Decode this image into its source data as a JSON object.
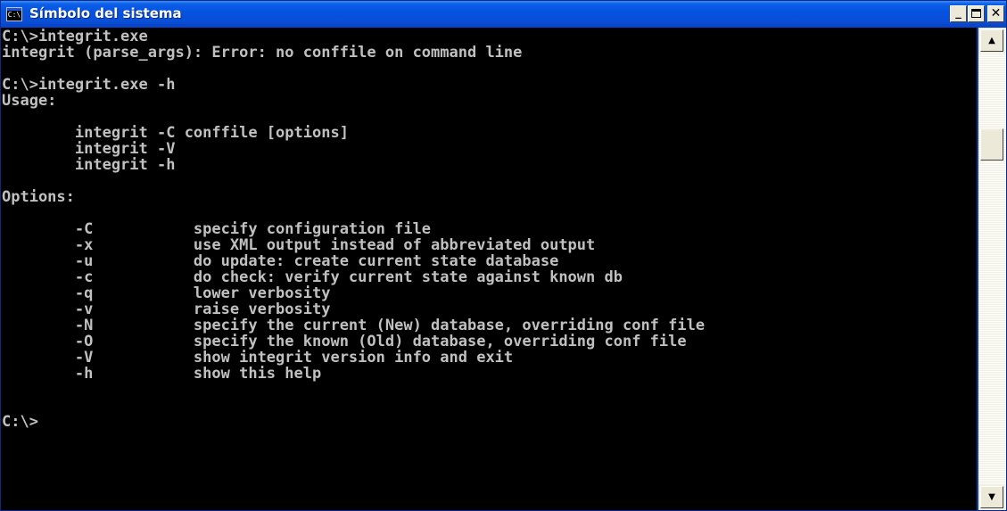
{
  "window": {
    "title": "Símbolo del sistema",
    "icon_text": "C:\\",
    "icon_name": "cmd-icon",
    "buttons": {
      "minimize_label": "_",
      "close_label": "✕"
    }
  },
  "console": {
    "lines": [
      "C:\\>integrit.exe",
      "integrit (parse_args): Error: no conffile on command line",
      "",
      "C:\\>integrit.exe -h",
      "Usage:",
      "",
      "        integrit -C conffile [options]",
      "        integrit -V",
      "        integrit -h",
      "",
      "Options:",
      "",
      "        -C           specify configuration file",
      "        -x           use XML output instead of abbreviated output",
      "        -u           do update: create current state database",
      "        -c           do check: verify current state against known db",
      "        -q           lower verbosity",
      "        -v           raise verbosity",
      "        -N           specify the current (New) database, overriding conf file",
      "        -O           specify the known (Old) database, overriding conf file",
      "        -V           show integrit version info and exit",
      "        -h           show this help",
      "",
      "",
      "C:\\>"
    ]
  },
  "scrollbar": {
    "up_arrow": "▲",
    "down_arrow": "▼"
  },
  "colors": {
    "console_background": "#000000",
    "console_text": "#c0c0c0",
    "titlebar": "#0a4fd8"
  }
}
